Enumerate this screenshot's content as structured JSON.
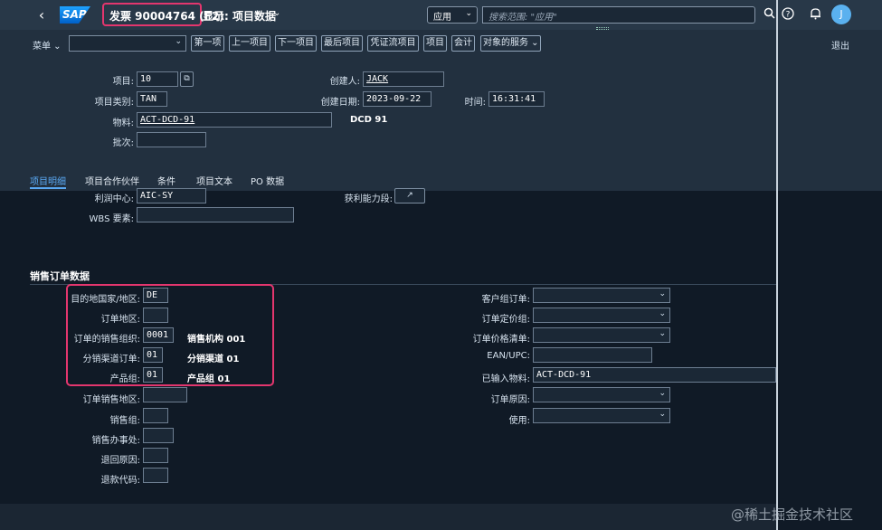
{
  "shell": {
    "title": "发票 90004764 (F2)",
    "subtitle": "显示: 项目数据",
    "scope": "应用",
    "search_placeholder": "搜索范围: \"应用\"",
    "avatar_initial": "J"
  },
  "toolbar": {
    "menu": "菜单",
    "buttons": [
      "第一项",
      "上一项目",
      "下一项目",
      "最后项目",
      "凭证流项目",
      "项目",
      "会计",
      "对象的服务"
    ],
    "exit": "退出"
  },
  "header": {
    "item_label": "项目:",
    "item_value": "10",
    "item_category_label": "项目类别:",
    "item_category_value": "TAN",
    "material_label": "物料:",
    "material_value": "ACT-DCD-91",
    "material_desc": "DCD 91",
    "batch_label": "批次:",
    "batch_value": "",
    "created_by_label": "创建人:",
    "created_by_value": "JACK",
    "created_on_label": "创建日期:",
    "created_on_value": "2023-09-22",
    "time_label": "时间:",
    "time_value": "16:31:41"
  },
  "tabs": [
    "项目明细",
    "项目合作伙伴",
    "条件",
    "项目文本",
    "PO 数据"
  ],
  "item_detail": {
    "profit_center_label": "利润中心:",
    "profit_center_value": "AIC-SY",
    "profitability_segment_label": "获利能力段:",
    "wbs_label": "WBS 要素:",
    "wbs_value": ""
  },
  "sales_order": {
    "section_title": "销售订单数据",
    "left": [
      {
        "label": "目的地国家/地区:",
        "value": "DE",
        "desc": ""
      },
      {
        "label": "订单地区:",
        "value": "",
        "desc": ""
      },
      {
        "label": "订单的销售组织:",
        "value": "0001",
        "desc": "销售机构 001"
      },
      {
        "label": "分销渠道订单:",
        "value": "01",
        "desc": "分销渠道 01"
      },
      {
        "label": "产品组:",
        "value": "01",
        "desc": "产品组 01"
      },
      {
        "label": "订单销售地区:",
        "value": "",
        "desc": ""
      },
      {
        "label": "销售组:",
        "value": "",
        "desc": ""
      },
      {
        "label": "销售办事处:",
        "value": "",
        "desc": ""
      },
      {
        "label": "退回原因:",
        "value": "",
        "desc": ""
      },
      {
        "label": "退款代码:",
        "value": "",
        "desc": ""
      }
    ],
    "right": [
      {
        "label": "客户组订单:",
        "value": ""
      },
      {
        "label": "订单定价组:",
        "value": ""
      },
      {
        "label": "订单价格清单:",
        "value": ""
      },
      {
        "label": "EAN/UPC:",
        "value": ""
      },
      {
        "label": "已输入物料:",
        "value": "ACT-DCD-91"
      },
      {
        "label": "订单原因:",
        "value": ""
      },
      {
        "label": "使用:",
        "value": ""
      }
    ]
  },
  "watermark": "@稀土掘金技术社区"
}
